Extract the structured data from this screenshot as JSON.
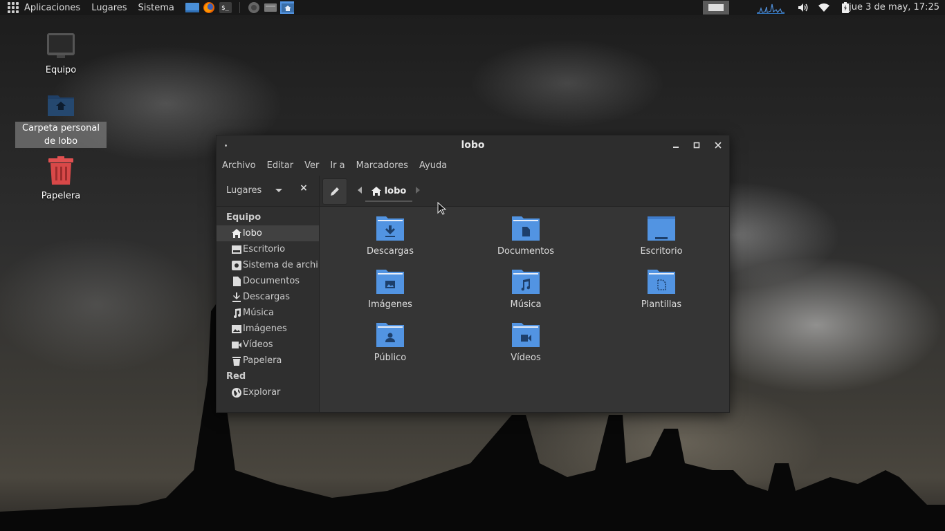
{
  "panel": {
    "menu": [
      "Aplicaciones",
      "Lugares",
      "Sistema"
    ],
    "clock": "jue  3 de may, 17:25"
  },
  "desktop": {
    "icons": [
      {
        "label": "Equipo"
      },
      {
        "label": "Carpeta personal de lobo"
      },
      {
        "label": "Papelera"
      }
    ]
  },
  "window": {
    "title": "lobo",
    "menubar": [
      "Archivo",
      "Editar",
      "Ver",
      "Ir a",
      "Marcadores",
      "Ayuda"
    ],
    "places_label": "Lugares",
    "breadcrumb": "lobo",
    "sidebar": {
      "sections": [
        {
          "heading": "Equipo",
          "items": [
            "lobo",
            "Escritorio",
            "Sistema de archi...",
            "Documentos",
            "Descargas",
            "Música",
            "Imágenes",
            "Vídeos",
            "Papelera"
          ]
        },
        {
          "heading": "Red",
          "items": [
            "Explorar"
          ]
        }
      ]
    },
    "folders": [
      "Descargas",
      "Documentos",
      "Escritorio",
      "Imágenes",
      "Música",
      "Plantillas",
      "Público",
      "Vídeos"
    ]
  },
  "colors": {
    "folder": "#5294e2",
    "panel": "#181818",
    "window": "#353535"
  }
}
